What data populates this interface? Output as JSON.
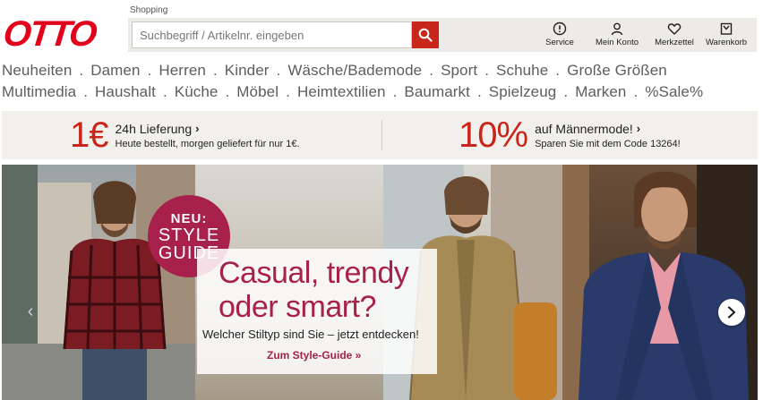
{
  "header": {
    "logo": "OTTO",
    "shopping_label": "Shopping",
    "search_placeholder": "Suchbegriff / Artikelnr. eingeben",
    "icons": [
      {
        "label": "Service",
        "icon": "info-circle-icon"
      },
      {
        "label": "Mein Konto",
        "icon": "user-icon"
      },
      {
        "label": "Merkzettel",
        "icon": "heart-icon"
      },
      {
        "label": "Warenkorb",
        "icon": "cart-icon"
      }
    ],
    "brand_color": "#e3001b",
    "accent_color": "#c9261b"
  },
  "nav": {
    "row1": [
      "Neuheiten",
      "Damen",
      "Herren",
      "Kinder",
      "Wäsche/Bademode",
      "Sport",
      "Schuhe",
      "Große Größen"
    ],
    "row2": [
      "Multimedia",
      "Haushalt",
      "Küche",
      "Möbel",
      "Heimtextilien",
      "Baumarkt",
      "Spielzeug",
      "Marken",
      "%Sale%"
    ]
  },
  "promo": {
    "left": {
      "big": "1€",
      "title": "24h Lieferung",
      "sub": "Heute bestellt, morgen geliefert für nur 1€."
    },
    "right": {
      "big": "10%",
      "title": "auf Männermode!",
      "sub": "Sparen Sie mit dem Code 13264!"
    },
    "chevron": "›"
  },
  "hero": {
    "badge_line1": "NEU:",
    "badge_line2": "STYLE",
    "badge_line3": "GUIDE",
    "headline_line1": "Casual, trendy",
    "headline_line2": "oder smart?",
    "subline": "Welcher Stiltyp sind Sie – jetzt entdecken!",
    "link": "Zum Style-Guide »",
    "accent_color": "#a7214c",
    "arrow_left": "‹",
    "arrow_right": "›"
  }
}
